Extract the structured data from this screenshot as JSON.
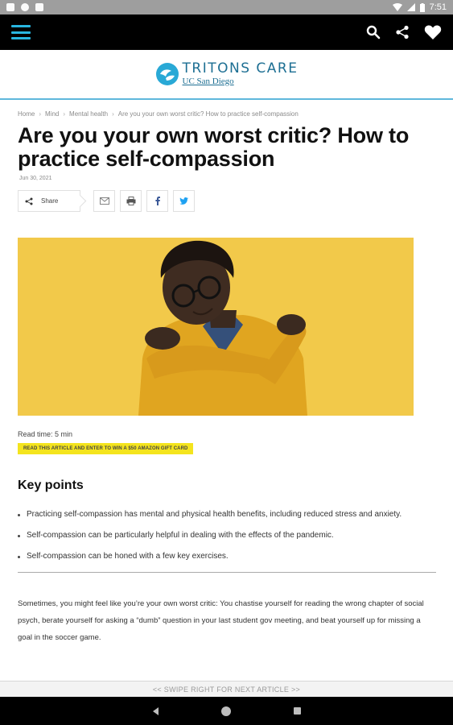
{
  "status_bar": {
    "time": "7:51"
  },
  "app": {
    "logo_title": "TRITONS CARE",
    "logo_sub": "UC San Diego"
  },
  "breadcrumb": [
    "Home",
    "Mind",
    "Mental health",
    "Are you your own worst critic? How to practice self-compassion"
  ],
  "article": {
    "title": "Are you your own worst critic? How to practice self-compassion",
    "date": "Jun 30, 2021",
    "share_label": "Share",
    "read_time": "Read time: 5 min",
    "promo": "READ THIS ARTICLE AND ENTER TO WIN A $50 AMAZON GIFT CARD",
    "key_points_heading": "Key points",
    "key_points": [
      "Practicing self-compassion has mental and physical health benefits, including reduced stress and anxiety.",
      "Self-compassion can be particularly helpful in dealing with the effects of the pandemic.",
      "Self-compassion can be honed with a few key exercises."
    ],
    "paragraph": "Sometimes, you might feel like you’re your own worst critic: You chastise yourself for reading the wrong chapter of social psych, berate yourself for asking a “dumb” question in your last student gov meeting, and beat yourself up for missing a goal in the soccer game."
  },
  "swipe_hint": "<< SWIPE RIGHT FOR NEXT ARTICLE >>",
  "colors": {
    "accent": "#29b6e0",
    "hero_bg": "#f2c94a",
    "promo_bg": "#f4e41e",
    "brand": "#1d6f93"
  },
  "icons": {
    "menu": "hamburger-menu-icon",
    "search": "search-icon",
    "share": "share-icon",
    "favorite": "heart-icon",
    "email": "mail-icon",
    "print": "printer-icon",
    "facebook": "facebook-icon",
    "twitter": "twitter-icon"
  }
}
